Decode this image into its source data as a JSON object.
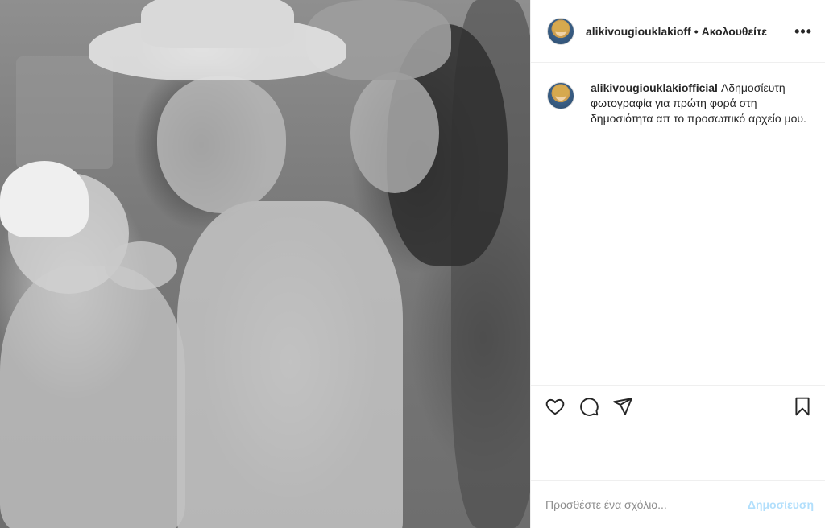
{
  "header": {
    "username": "alikivougiouklakioff",
    "separator": "•",
    "follow_status": "Ακολουθείτε",
    "more_icon": "more-horizontal-icon",
    "more_label": "•••"
  },
  "caption": {
    "username": "alikivougiouklakiofficial",
    "text": "Αδημοσίευτη φωτογραφία για πρώτη φορά στη δημοσιότητα απ το προσωπικό αρχείο μου."
  },
  "actions": {
    "like_icon": "heart-icon",
    "comment_icon": "comment-icon",
    "share_icon": "paper-plane-icon",
    "save_icon": "bookmark-icon"
  },
  "comment_box": {
    "placeholder": "Προσθέστε ένα σχόλιο...",
    "post_label": "Δημοσίευση",
    "post_color": "#b2dffc"
  },
  "photo": {
    "tone": "black-and-white"
  }
}
